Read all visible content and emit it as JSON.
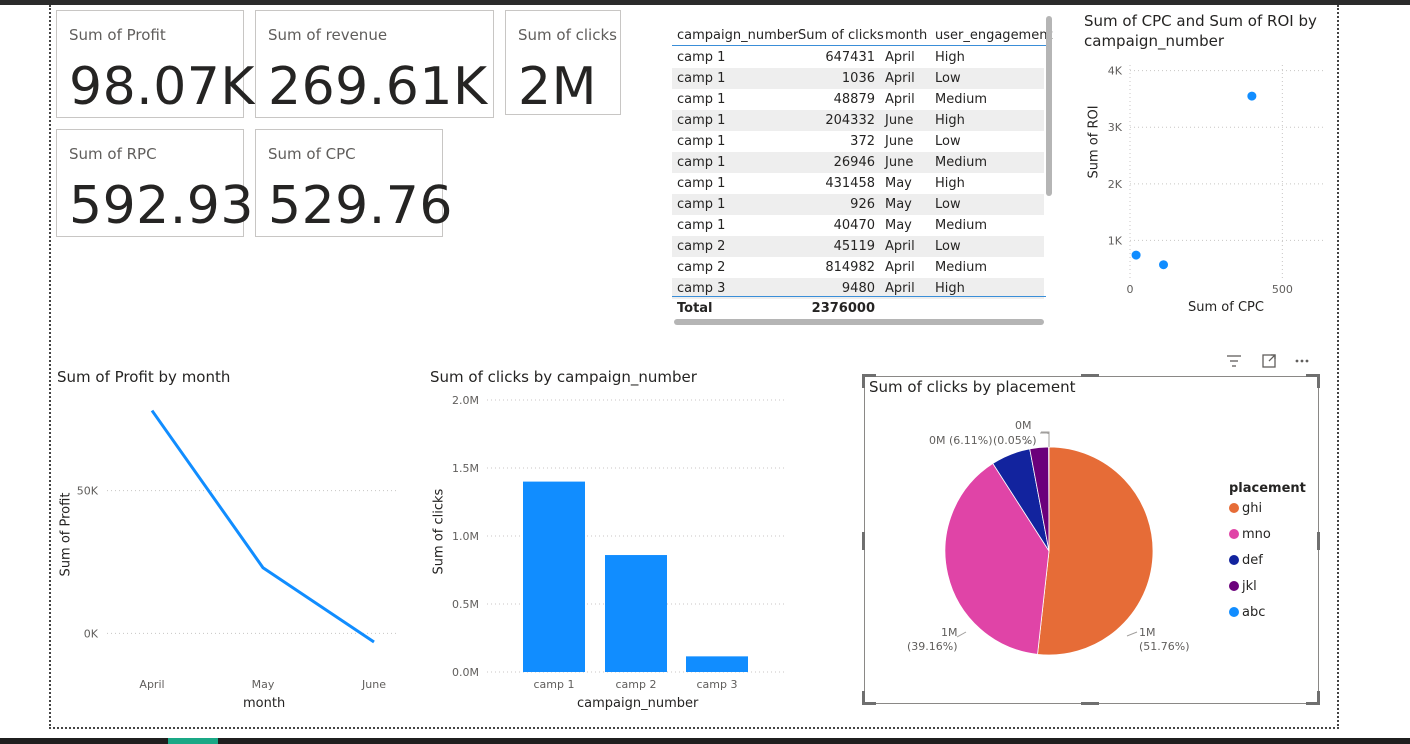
{
  "cards": [
    {
      "label": "Sum of Profit",
      "value": "98.07K"
    },
    {
      "label": "Sum of revenue",
      "value": "269.61K"
    },
    {
      "label": "Sum of clicks",
      "value": "2M"
    },
    {
      "label": "Sum of RPC",
      "value": "592.93"
    },
    {
      "label": "Sum of CPC",
      "value": "529.76"
    }
  ],
  "table": {
    "columns": [
      "campaign_number",
      "Sum of clicks",
      "month",
      "user_engagement"
    ],
    "rows": [
      [
        "camp 1",
        "647431",
        "April",
        "High"
      ],
      [
        "camp 1",
        "1036",
        "April",
        "Low"
      ],
      [
        "camp 1",
        "48879",
        "April",
        "Medium"
      ],
      [
        "camp 1",
        "204332",
        "June",
        "High"
      ],
      [
        "camp 1",
        "372",
        "June",
        "Low"
      ],
      [
        "camp 1",
        "26946",
        "June",
        "Medium"
      ],
      [
        "camp 1",
        "431458",
        "May",
        "High"
      ],
      [
        "camp 1",
        "926",
        "May",
        "Low"
      ],
      [
        "camp 1",
        "40470",
        "May",
        "Medium"
      ],
      [
        "camp 2",
        "45119",
        "April",
        "Low"
      ],
      [
        "camp 2",
        "814982",
        "April",
        "Medium"
      ],
      [
        "camp 3",
        "9480",
        "April",
        "High"
      ]
    ],
    "total_label": "Total",
    "total_value": "2376000"
  },
  "scatter_titles": {
    "title": "Sum of CPC and Sum of ROI by campaign_number",
    "xlabel": "Sum of CPC",
    "ylabel": "Sum of ROI",
    "yticks": [
      "4K",
      "3K",
      "2K",
      "1K"
    ],
    "xticks": [
      "0",
      "500"
    ]
  },
  "line_titles": {
    "title": "Sum of Profit by month",
    "xlabel": "month",
    "ylabel": "Sum of Profit",
    "yticks": [
      "50K",
      "0K"
    ]
  },
  "bar_titles": {
    "title": "Sum of clicks by campaign_number",
    "xlabel": "campaign_number",
    "ylabel": "Sum of clicks",
    "yticks": [
      "2.0M",
      "1.5M",
      "1.0M",
      "0.5M",
      "0.0M"
    ]
  },
  "pie_titles": {
    "title": "Sum of clicks by placement",
    "legend_title": "placement",
    "labels": {
      "ghi": "1M\n(51.76%)",
      "mno": "1M\n(39.16%)",
      "def": "0M (6.11%)",
      "jkl": "(0.05%)",
      "abc": "0M"
    }
  },
  "chart_data": [
    {
      "type": "scatter",
      "title": "Sum of CPC and Sum of ROI by campaign_number",
      "xlabel": "Sum of CPC",
      "ylabel": "Sum of ROI",
      "xlim": [
        0,
        640
      ],
      "ylim": [
        300,
        4100
      ],
      "points": [
        {
          "x": 20,
          "y": 740
        },
        {
          "x": 110,
          "y": 570
        },
        {
          "x": 400,
          "y": 3550
        }
      ]
    },
    {
      "type": "line",
      "title": "Sum of Profit by month",
      "xlabel": "month",
      "ylabel": "Sum of Profit",
      "categories": [
        "April",
        "May",
        "June"
      ],
      "values": [
        78000,
        23000,
        -3000
      ],
      "ylim": [
        -10000,
        88000
      ],
      "color": "#118dff"
    },
    {
      "type": "bar",
      "title": "Sum of clicks by campaign_number",
      "xlabel": "campaign_number",
      "ylabel": "Sum of clicks",
      "categories": [
        "camp 1",
        "camp 2",
        "camp 3"
      ],
      "values": [
        1400000,
        860000,
        115000
      ],
      "ylim": [
        0,
        2000000
      ],
      "color": "#118dff"
    },
    {
      "type": "pie",
      "title": "Sum of clicks by placement",
      "legend_title": "placement",
      "slices": [
        {
          "name": "ghi",
          "percent": 51.76,
          "color": "#e66c37"
        },
        {
          "name": "mno",
          "percent": 39.16,
          "color": "#e044a7"
        },
        {
          "name": "def",
          "percent": 6.11,
          "color": "#12239e"
        },
        {
          "name": "jkl",
          "percent": 2.92,
          "color": "#6b007b"
        },
        {
          "name": "abc",
          "percent": 0.05,
          "color": "#118dff"
        }
      ]
    }
  ]
}
